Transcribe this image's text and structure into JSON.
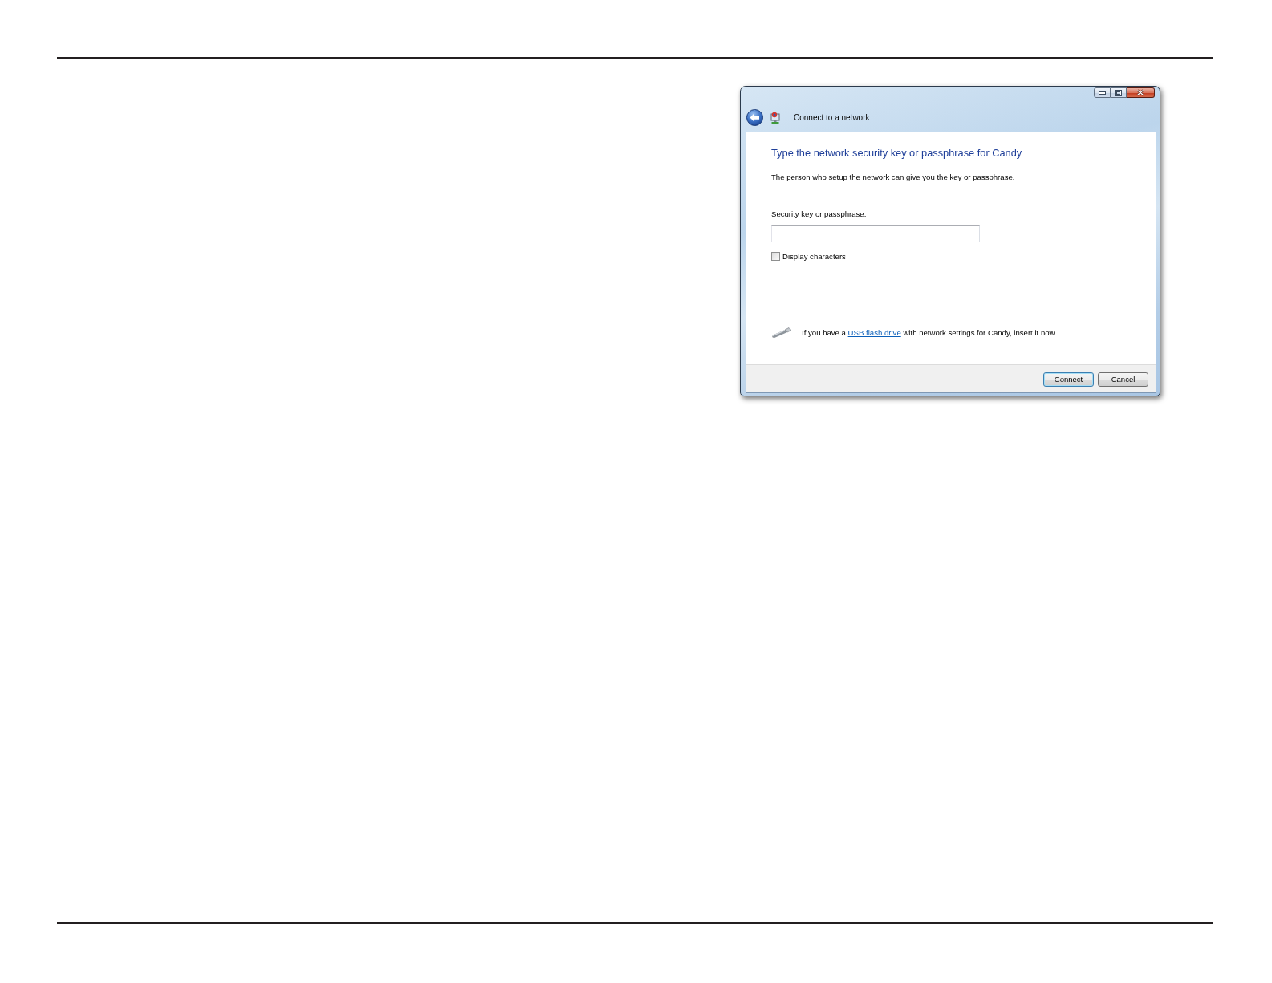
{
  "dialog": {
    "title": "Connect to a network",
    "heading": "Type the network security key or passphrase for Candy",
    "description": "The person who setup the network can give you the key or passphrase.",
    "passphrase": {
      "label": "Security key or passphrase:"
    },
    "display_characters": {
      "label": "Display characters",
      "checked": false
    },
    "usb_hint": {
      "before": "If you have a",
      "link": "USB flash drive",
      "after": "with network settings for Candy, insert it now."
    },
    "buttons": [
      {
        "label": "Connect",
        "default": true
      },
      {
        "label": "Cancel",
        "default": false
      }
    ]
  }
}
